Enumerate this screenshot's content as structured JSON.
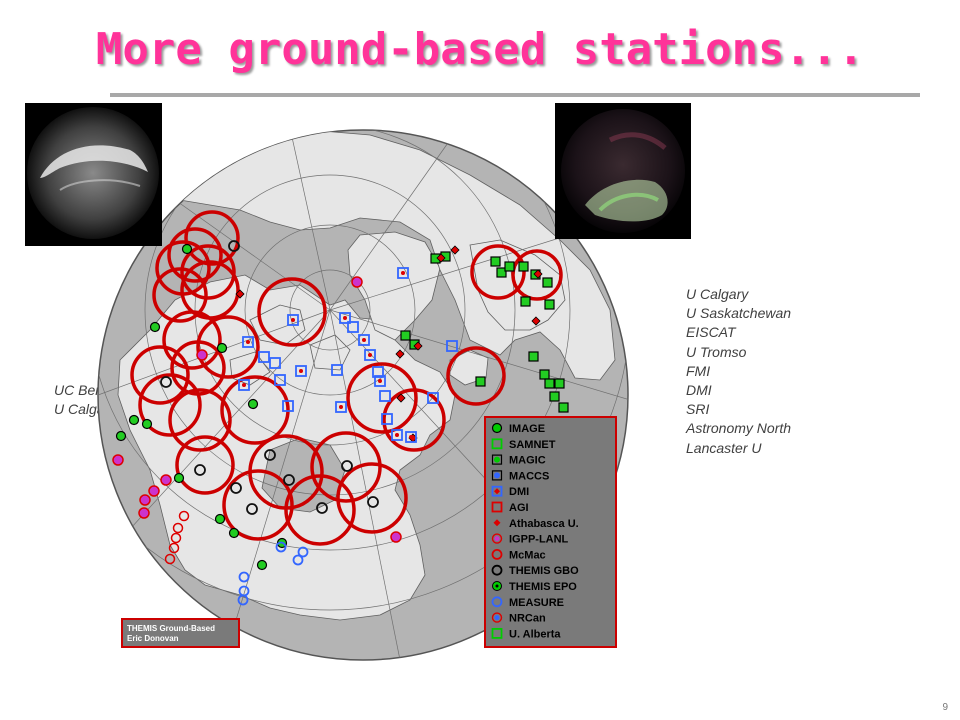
{
  "slide": {
    "title": "More ground-based stations...",
    "page_number": "9"
  },
  "institutions_right": [
    "U Calgary",
    "U Saskatchewan",
    "EISCAT",
    "U Tromso",
    "FMI",
    "DMI",
    "SRI",
    "Astronomy North",
    "Lancaster U"
  ],
  "institutions_left": [
    "UC Berkel",
    "U Calgary"
  ],
  "map": {
    "credit_line1": "THEMIS Ground-Based",
    "credit_line2": "Eric Donovan",
    "legend": [
      {
        "label": "IMAGE",
        "symbol": "filled-circle",
        "color": "#00cc00"
      },
      {
        "label": "SAMNET",
        "symbol": "square",
        "color": "#00cc00"
      },
      {
        "label": "MAGIC",
        "symbol": "filled-circle-square",
        "color": "#00cc00"
      },
      {
        "label": "MACCS",
        "symbol": "filled-circle-square",
        "color": "#3366ff"
      },
      {
        "label": "DMI",
        "symbol": "diamond-square",
        "color": "#3366ff"
      },
      {
        "label": "AGI",
        "symbol": "square",
        "color": "#dd0000"
      },
      {
        "label": "Athabasca U.",
        "symbol": "diamond",
        "color": "#dd0000"
      },
      {
        "label": "IGPP-LANL",
        "symbol": "circle-ring",
        "color": "#cc33cc"
      },
      {
        "label": "McMac",
        "symbol": "circle",
        "color": "#dd0000"
      },
      {
        "label": "THEMIS GBO",
        "symbol": "circle",
        "color": "#000000"
      },
      {
        "label": "THEMIS EPO",
        "symbol": "filled-circle-dot",
        "color": "#00cc00"
      },
      {
        "label": "MEASURE",
        "symbol": "circle",
        "color": "#3366ff"
      },
      {
        "label": "NRCan",
        "symbol": "circle-ring",
        "color": "#3366ff"
      },
      {
        "label": "U. Alberta",
        "symbol": "square",
        "color": "#00cc00"
      }
    ]
  },
  "colors": {
    "title": "#ff3399",
    "ocean": "#b4b4b4",
    "land": "#e6e6e6",
    "fov_ring": "#cc0000",
    "legend_bg": "#7a7a7a"
  },
  "icons": {
    "allsky_left": "grayscale all-sky auroral image",
    "allsky_right": "color all-sky auroral image"
  }
}
